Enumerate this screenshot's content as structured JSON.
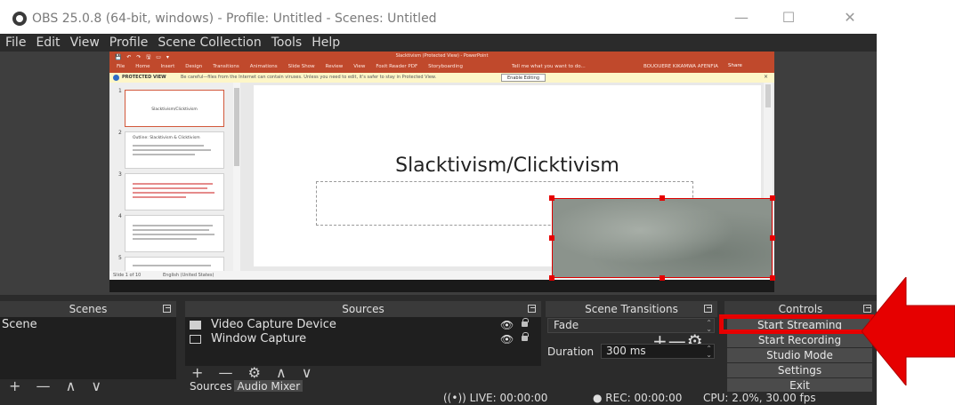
{
  "window": {
    "title": "OBS 25.0.8 (64-bit, windows) - Profile: Untitled - Scenes: Untitled",
    "minimize_glyph": "—",
    "maximize_glyph": "☐",
    "close_glyph": "✕"
  },
  "menu": [
    "File",
    "Edit",
    "View",
    "Profile",
    "Scene Collection",
    "Tools",
    "Help"
  ],
  "preview": {
    "ppt_title": "Slacktivism (Protected View) - PowerPoint",
    "ppt_quick": "💾 ↶ ↷ 🖫 ▭ ▾",
    "ppt_tabs": [
      "File",
      "Home",
      "Insert",
      "Design",
      "Transitions",
      "Animations",
      "Slide Show",
      "Review",
      "View",
      "Foxit Reader PDF",
      "Storyboarding"
    ],
    "ppt_tellme": "Tell me what you want to do...",
    "ppt_user": "BOUOUERE KIKAMWA AFENFIA",
    "ppt_share": "Share",
    "protected_label": "PROTECTED VIEW",
    "protected_msg": "Be careful—files from the Internet can contain viruses. Unless you need to edit, it's safer to stay in Protected View.",
    "enable_editing": "Enable Editing",
    "thumb_numbers": [
      "1",
      "2",
      "3",
      "4",
      "5"
    ],
    "thumb1_title": "Slacktivism/Clicktivism",
    "thumb2_title": "Outline: Slacktivism & Clicktivism",
    "slide_title": "Slacktivism/Clicktivism",
    "status_slide": "Slide 1 of 10",
    "status_lang": "English (United States)"
  },
  "docks": {
    "scenes": {
      "header": "Scenes",
      "items": [
        "Scene"
      ],
      "tools": "+ — ∧ ∨"
    },
    "sources": {
      "header": "Sources",
      "items": [
        {
          "name": "Video Capture Device",
          "eye": "👁"
        },
        {
          "name": "Window Capture",
          "eye": "👁"
        }
      ],
      "tools": "+ — ⚙ ∧ ∨",
      "tabs": [
        "Sources",
        "Audio Mixer"
      ]
    },
    "transitions": {
      "header": "Scene Transitions",
      "selected": "Fade",
      "tools": "+—⚙",
      "duration_label": "Duration",
      "duration_value": "300 ms"
    },
    "controls": {
      "header": "Controls",
      "buttons": [
        "Start Streaming",
        "Start Recording",
        "Studio Mode",
        "Settings",
        "Exit"
      ]
    }
  },
  "status": {
    "live": "((•)) LIVE: 00:00:00",
    "rec": "● REC: 00:00:00",
    "cpu": "CPU: 2.0%, 30.00 fps"
  },
  "annotation": {
    "highlight_color": "#e60000",
    "arrow_color": "#e60000"
  }
}
